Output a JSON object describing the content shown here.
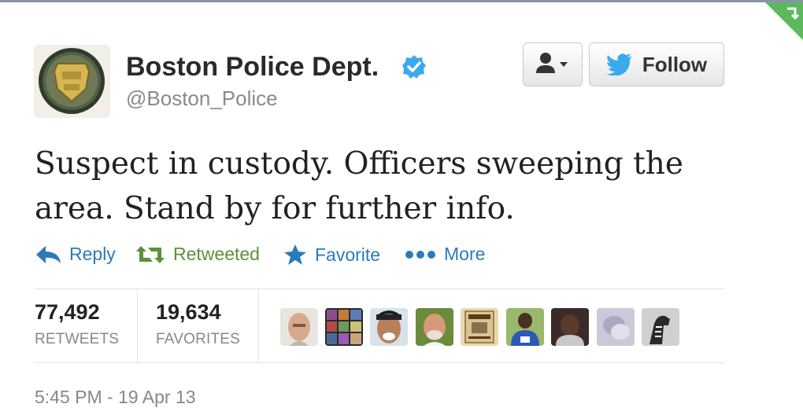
{
  "author": {
    "name": "Boston Police Dept.",
    "handle": "@Boston_Police",
    "avatar_icon": "police-badge-icon",
    "verified_icon": "verified-badge-icon"
  },
  "buttons": {
    "user_menu_icon": "user-dropdown-icon",
    "follow_label": "Follow"
  },
  "tweet": {
    "text": "Suspect in custody. Officers sweeping the area. Stand by for further info."
  },
  "actions": {
    "reply": "Reply",
    "retweet": "Retweeted",
    "favorite": "Favorite",
    "more": "More"
  },
  "stats": {
    "retweets_count": "77,492",
    "retweets_label": "RETWEETS",
    "favorites_count": "19,634",
    "favorites_label": "FAVORITES"
  },
  "timestamp": "5:45 PM - 19 Apr 13",
  "colors": {
    "link_blue": "#2b7bb9",
    "retweeted_green": "#5c913b",
    "verified_blue": "#3ba9ee",
    "corner_green": "#5cb85c"
  }
}
